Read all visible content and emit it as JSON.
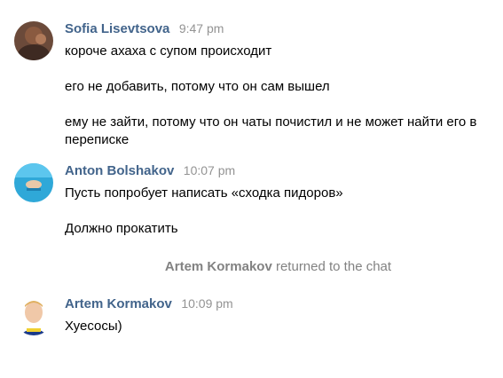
{
  "messages": [
    {
      "author": "Sofia Lisevtsova",
      "time": "9:47 pm",
      "texts": [
        "короче ахаха с супом происходит",
        "его не добавить, потому что он сам вышел",
        "ему не зайти, потому что он чаты почистил и не может найти его в переписке"
      ]
    },
    {
      "author": "Anton Bolshakov",
      "time": "10:07 pm",
      "texts": [
        "Пусть попробует написать «сходка пидоров»",
        "Должно прокатить"
      ]
    },
    {
      "author": "Artem Kormakov",
      "time": "10:09 pm",
      "texts": [
        "Хуесосы)"
      ]
    }
  ],
  "service": {
    "name": "Artem Kormakov",
    "action": "returned to the chat"
  },
  "colors": {
    "author": "#42648b",
    "time": "#939393",
    "service": "#828282"
  }
}
